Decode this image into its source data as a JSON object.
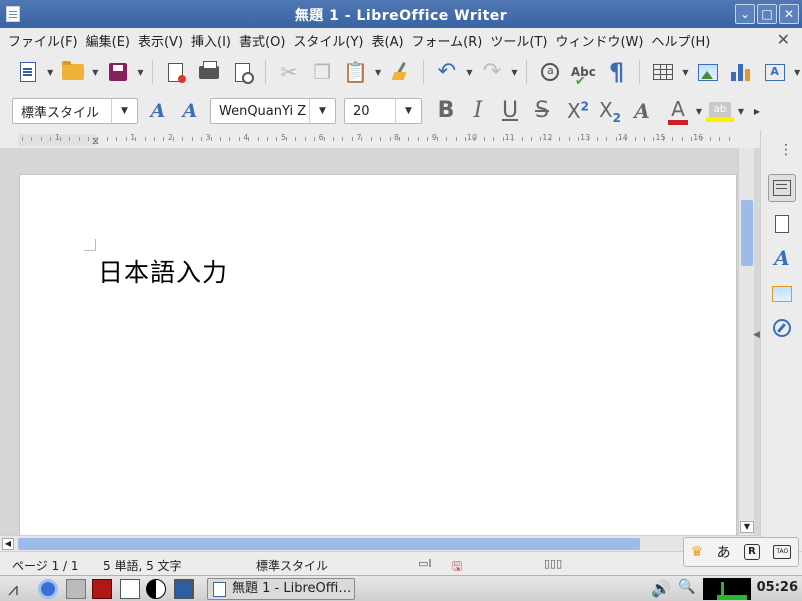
{
  "window": {
    "title": "無題 1 - LibreOffice Writer",
    "buttons": [
      "⌄",
      "□",
      "✕"
    ]
  },
  "menubar": {
    "items": [
      "ファイル(F)",
      "編集(E)",
      "表示(V)",
      "挿入(I)",
      "書式(O)",
      "スタイル(Y)",
      "表(A)",
      "フォーム(R)",
      "ツール(T)",
      "ウィンドウ(W)",
      "ヘルプ(H)"
    ],
    "close": "✕"
  },
  "formatting": {
    "paragraph_style": "標準スタイル",
    "font_name": "WenQuanYi Z",
    "font_size": "20",
    "font_color": "#cc1f1f",
    "highlight_color": "#ffee00",
    "highlight_label": "ab"
  },
  "ruler": {
    "numbers": [
      "1",
      "1",
      "2",
      "3",
      "4",
      "5",
      "6",
      "7",
      "8",
      "9",
      "10",
      "11",
      "12",
      "13",
      "14",
      "15",
      "16"
    ]
  },
  "document": {
    "text": "日本語入力"
  },
  "statusbar": {
    "page": "ページ 1 / 1",
    "word_count": "5 単語, 5 文字",
    "page_style": "標準スタイル"
  },
  "ime": {
    "mode": "あ",
    "r": "R",
    "tao": "TAO"
  },
  "taskbar": {
    "task_label": "無題 1 - LibreOffi…",
    "clock": "05:26"
  }
}
